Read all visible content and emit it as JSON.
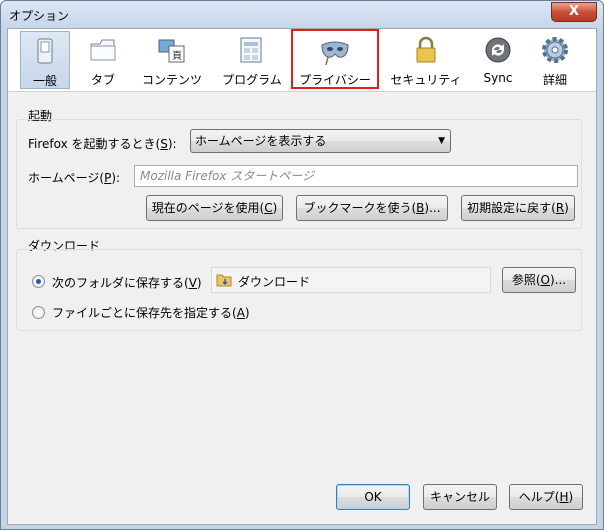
{
  "window": {
    "title": "オプション",
    "close_glyph": "X"
  },
  "toolbar": {
    "panes": [
      {
        "label": "一般",
        "icon": "general-switch-icon"
      },
      {
        "label": "タブ",
        "icon": "tabs-icon"
      },
      {
        "label": "コンテンツ",
        "icon": "content-icon"
      },
      {
        "label": "プログラム",
        "icon": "applications-icon"
      },
      {
        "label": "プライバシー",
        "icon": "privacy-mask-icon"
      },
      {
        "label": "セキュリティ",
        "icon": "security-lock-icon"
      },
      {
        "label": "Sync",
        "icon": "sync-icon"
      },
      {
        "label": "詳細",
        "icon": "advanced-gear-icon"
      }
    ],
    "selected": "一般",
    "highlighted": "プライバシー"
  },
  "startup": {
    "group_label": "起動",
    "when_starts_label": "Firefox を起動するとき(",
    "when_starts_key": "S",
    "when_starts_tail": "):",
    "when_starts_value": "ホームページを表示する",
    "homepage_label": "ホームページ(",
    "homepage_key": "P",
    "homepage_tail": "):",
    "homepage_placeholder": "Mozilla Firefox スタートページ",
    "use_current_btn": "現在のページを使用(",
    "use_current_key": "C",
    "use_bookmark_btn": "ブックマークを使う(",
    "use_bookmark_key": "B",
    "use_bookmark_tail": ")...",
    "restore_default_btn": "初期設定に戻す(",
    "restore_default_key": "R"
  },
  "downloads": {
    "group_label": "ダウンロード",
    "save_to_label": "次のフォルダに保存する(",
    "save_to_key": "V",
    "folder_name": "ダウンロード",
    "browse_btn": "参照(",
    "browse_key": "O",
    "browse_tail": ")...",
    "always_ask_label": "ファイルごとに保存先を指定する(",
    "always_ask_key": "A"
  },
  "footer": {
    "ok": "OK",
    "cancel": "キャンセル",
    "help": "ヘルプ(",
    "help_key": "H"
  },
  "colors": {
    "highlight_border": "#e0201c",
    "selected_tab": "#c7d6ea"
  }
}
